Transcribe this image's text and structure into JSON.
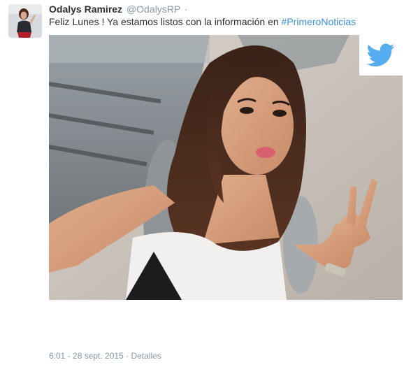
{
  "tweet": {
    "author_name": "Odalys Ramirez",
    "author_handle": "@OdalysRP",
    "separator": "·",
    "text": "Feliz Lunes ! Ya estamos listos con la información en ",
    "hashtag": "#PrimeroNoticias"
  },
  "footer": {
    "timestamp": "6:01 - 28 sept. 2015",
    "separator": "·",
    "details_link": "Detalles"
  },
  "colors": {
    "link": "#3b94d9",
    "muted": "#8899a6",
    "text": "#292f33",
    "twitter_brand": "#55acee"
  },
  "icons": {
    "avatar": "profile-photo",
    "media": "selfie-photo",
    "badge": "twitter-bird-icon"
  }
}
